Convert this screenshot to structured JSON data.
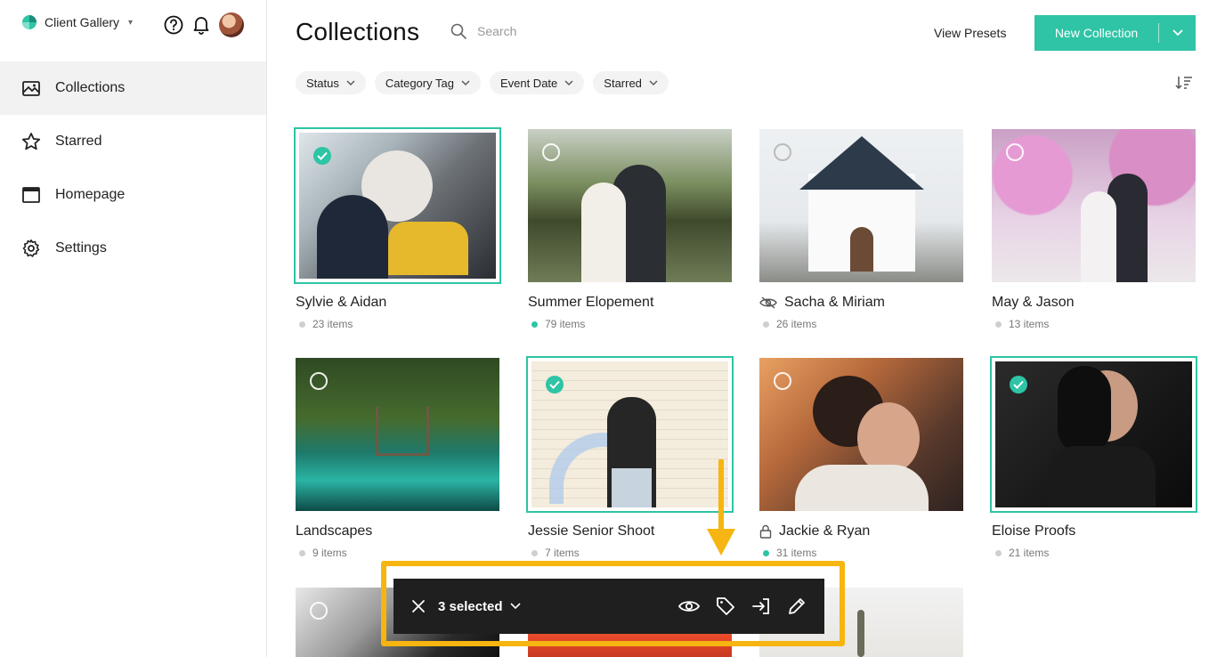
{
  "app": {
    "brand": "Client Gallery",
    "title": "Collections"
  },
  "nav": {
    "items": [
      {
        "label": "Collections",
        "icon": "collections-icon",
        "active": true
      },
      {
        "label": "Starred",
        "icon": "star-icon",
        "active": false
      },
      {
        "label": "Homepage",
        "icon": "homepage-icon",
        "active": false
      },
      {
        "label": "Settings",
        "icon": "gear-icon",
        "active": false
      }
    ]
  },
  "header": {
    "search_placeholder": "Search",
    "view_presets": "View Presets",
    "new_collection": "New Collection"
  },
  "filters": [
    "Status",
    "Category Tag",
    "Event Date",
    "Starred"
  ],
  "collections": [
    {
      "title": "Sylvie & Aidan",
      "items": "23 items",
      "status": "grey",
      "selected": true,
      "badge": ""
    },
    {
      "title": "Summer Elopement",
      "items": "79 items",
      "status": "green",
      "selected": false,
      "badge": ""
    },
    {
      "title": "Sacha & Miriam",
      "items": "26 items",
      "status": "grey",
      "selected": false,
      "badge": "hidden-eye-icon"
    },
    {
      "title": "May & Jason",
      "items": "13 items",
      "status": "grey",
      "selected": false,
      "badge": ""
    },
    {
      "title": "Landscapes",
      "items": "9 items",
      "status": "grey",
      "selected": false,
      "badge": ""
    },
    {
      "title": "Jessie Senior Shoot",
      "items": "7 items",
      "status": "grey",
      "selected": true,
      "badge": ""
    },
    {
      "title": "Jackie & Ryan",
      "items": "31 items",
      "status": "green",
      "selected": false,
      "badge": "lock-icon"
    },
    {
      "title": "Eloise Proofs",
      "items": "21 items",
      "status": "grey",
      "selected": true,
      "badge": ""
    }
  ],
  "toolbar": {
    "selected_label": "3 selected",
    "actions": [
      "eye-icon",
      "tag-icon",
      "move-into-icon",
      "pencil-icon"
    ]
  },
  "colors": {
    "accent": "#2ec4a5",
    "highlight": "#f6b510",
    "toolbar_bg": "#1f1f1f"
  }
}
